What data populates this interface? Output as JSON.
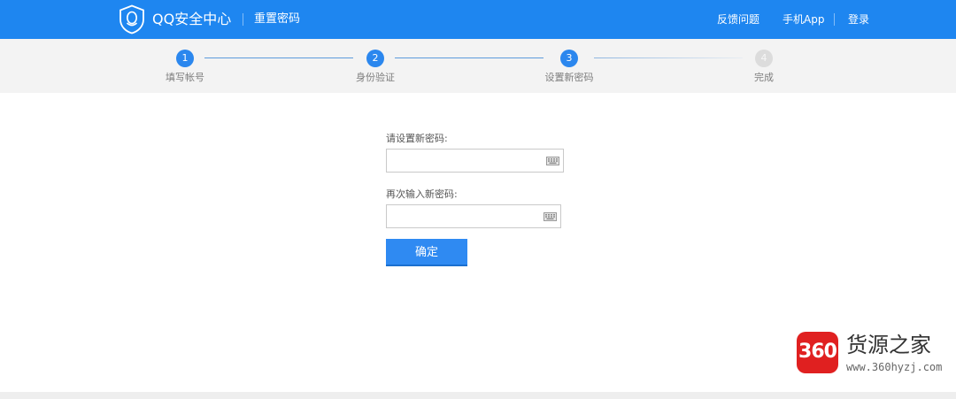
{
  "header": {
    "brand": "QQ安全中心",
    "page_name": "重置密码",
    "links": {
      "feedback": "反馈问题",
      "mobile_app": "手机App",
      "login": "登录"
    },
    "background_color": "#1e86f0",
    "logo_icon": "qq-shield-icon"
  },
  "steps": {
    "items": [
      {
        "number": "1",
        "label": "填写帐号",
        "state": "done"
      },
      {
        "number": "2",
        "label": "身份验证",
        "state": "done"
      },
      {
        "number": "3",
        "label": "设置新密码",
        "state": "current"
      },
      {
        "number": "4",
        "label": "完成",
        "state": "todo"
      }
    ],
    "active_color": "#2b87ee",
    "inactive_color": "#dcdcdc"
  },
  "form": {
    "new_password": {
      "label": "请设置新密码:",
      "value": "",
      "icon": "keyboard-icon"
    },
    "confirm_password": {
      "label": "再次输入新密码:",
      "value": "",
      "icon": "keyboard-icon"
    },
    "submit_label": "确定",
    "button_color": "#2f8af2"
  },
  "watermark": {
    "badge": "360",
    "name": "货源之家",
    "url": "www.360hyzj.com",
    "badge_color": "#e02020"
  }
}
